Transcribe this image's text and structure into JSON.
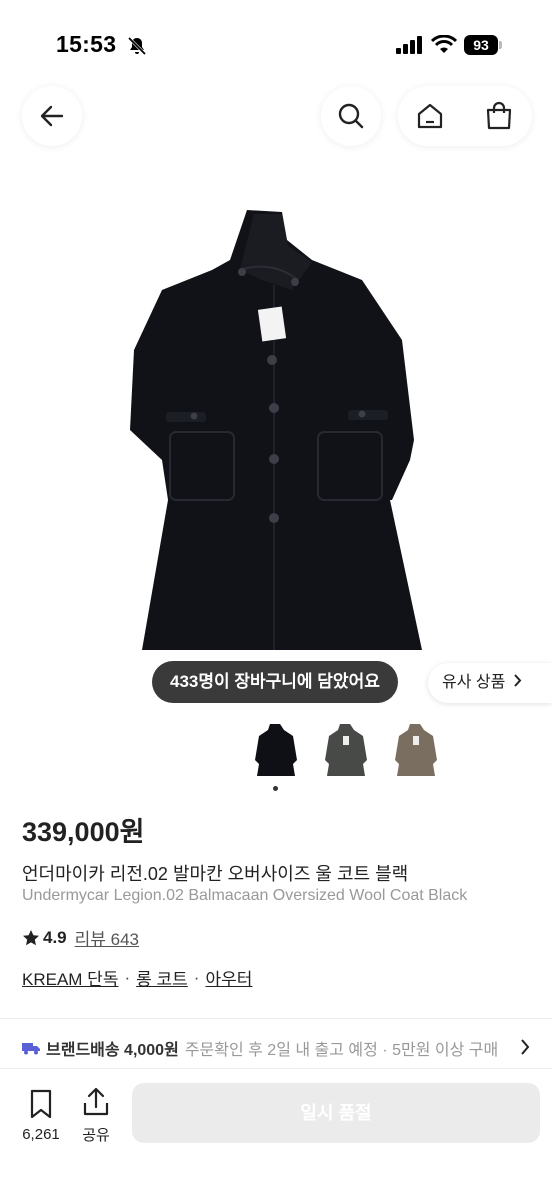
{
  "status_bar": {
    "time": "15:53",
    "battery": "93"
  },
  "nav": {
    "back_icon": "arrow-left-icon",
    "search_icon": "search-icon",
    "home_icon": "home-icon",
    "bag_icon": "shopping-bag-icon"
  },
  "gallery": {
    "cart_count_text": "433명이 장바구니에 담았어요",
    "similar_label": "유사 상품",
    "thumbnails": [
      "black",
      "charcoal",
      "brown"
    ],
    "current_index": 1
  },
  "product": {
    "price": "339,000원",
    "name_ko": "언더마이카 리전.02 발마칸 오버사이즈 울 코트 블랙",
    "name_en": "Undermycar Legion.02 Balmacaan Oversized Wool Coat Black",
    "rating": "4.9",
    "review_label": "리뷰 643",
    "categories": [
      "KREAM 단독",
      "롱 코트",
      "아우터"
    ]
  },
  "shipping": {
    "label": "브랜드배송 4,000원",
    "info": "주문확인 후 2일 내 출고 예정 · 5만원 이상 구매"
  },
  "bottom": {
    "bookmark_count": "6,261",
    "share_label": "공유",
    "cta_label": "일시 품절"
  },
  "colors": {
    "accent_truck": "#5a5fd6",
    "cta_disabled": "#ebebeb"
  }
}
